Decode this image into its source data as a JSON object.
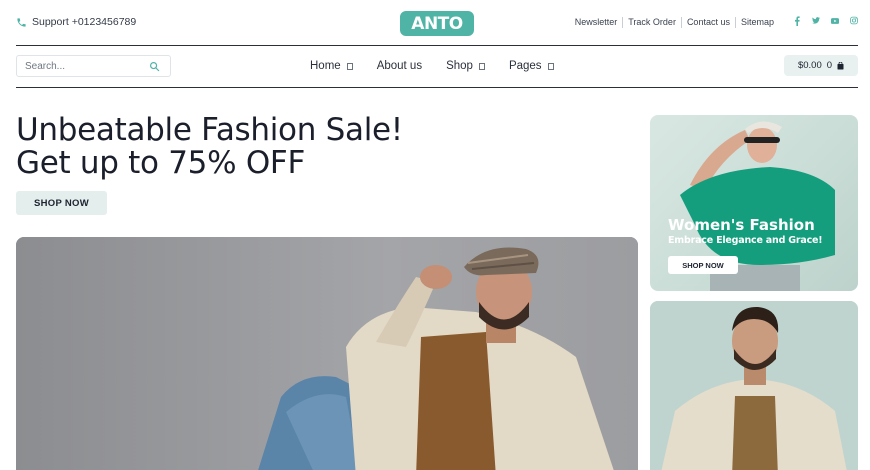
{
  "topbar": {
    "support_text": "Support +0123456789",
    "logo_text": "ANTO",
    "links": [
      "Newsletter",
      "Track Order",
      "Contact us",
      "Sitemap"
    ],
    "social_icons": [
      "facebook-icon",
      "twitter-icon",
      "youtube-icon",
      "instagram-icon"
    ],
    "accent_color": "#4fb3a5"
  },
  "nav": {
    "search_placeholder": "Search...",
    "menu": [
      {
        "label": "Home",
        "has_dropdown": true
      },
      {
        "label": "About us",
        "has_dropdown": false
      },
      {
        "label": "Shop",
        "has_dropdown": true
      },
      {
        "label": "Pages",
        "has_dropdown": true
      }
    ],
    "cart_total": "$0.00",
    "cart_count": "0"
  },
  "hero": {
    "headline_line1": "Unbeatable Fashion Sale!",
    "headline_line2": "Get up to 75% OFF",
    "cta_label": "SHOP NOW"
  },
  "promo_card": {
    "title": "Women's Fashion",
    "subtitle": "Embrace Elegance and Grace!",
    "cta_label": "SHOP NOW"
  }
}
